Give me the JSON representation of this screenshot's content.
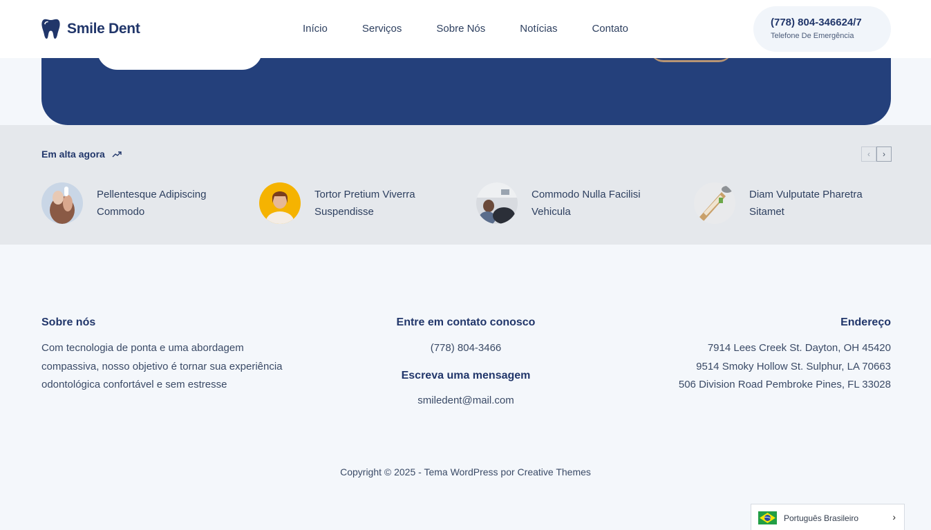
{
  "header": {
    "logo_text": "Smile Dent",
    "nav": [
      "Início",
      "Serviços",
      "Sobre Nós",
      "Notícias",
      "Contato"
    ],
    "phone": "(778) 804-346624/7",
    "phone_label": "Telefone De Emergência"
  },
  "trending": {
    "title": "Em alta agora",
    "items": [
      {
        "label": "Pellentesque Adipiscing Commodo"
      },
      {
        "label": "Tortor Pretium Viverra Suspendisse"
      },
      {
        "label": "Commodo Nulla Facilisi Vehicula"
      },
      {
        "label": "Diam Vulputate Pharetra Sitamet"
      }
    ]
  },
  "footer": {
    "about_title": "Sobre nós",
    "about_text": "Com tecnologia de ponta e uma abordagem compassiva, nosso objetivo é tornar sua experiência odontológica confortável e sem estresse",
    "contact_title": "Entre em contato conosco",
    "contact_phone": "(778) 804-3466",
    "message_title": "Escreva uma mensagem",
    "email": "smiledent@mail.com",
    "address_title": "Endereço",
    "addresses": [
      "7914 Lees Creek St. Dayton, OH 45420",
      "9514 Smoky Hollow St. Sulphur, LA 70663",
      "506 Division Road Pembroke Pines, FL 33028"
    ],
    "copyright": "Copyright © 2025 - Tema WordPress por Creative Themes"
  },
  "language": {
    "label": "Português Brasileiro"
  },
  "colors": {
    "brand_navy": "#21366a",
    "hero_blue": "#24407b",
    "trending_bg": "#e5e8ec",
    "page_bg": "#f4f7fb"
  }
}
